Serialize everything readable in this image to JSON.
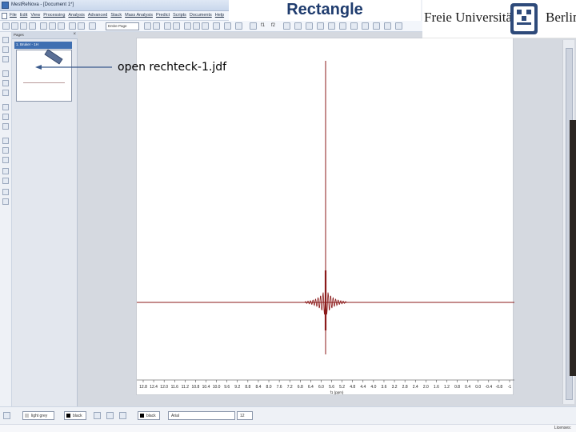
{
  "slide": {
    "title": "Rectangle",
    "logo": {
      "left_text": "Freie Universität",
      "right_text": "Berlin"
    },
    "annotation": "open rechteck-1.jdf"
  },
  "window": {
    "title": "MestReNova - [Document 1*]"
  },
  "menu": [
    "File",
    "Edit",
    "View",
    "Processing",
    "Analysis",
    "Advanced",
    "Stack",
    "Mass Analysis",
    "Predict",
    "Scripts",
    "Documents",
    "Help"
  ],
  "toolbar": {
    "page_mode": "Entire Page",
    "zoom_in": "f1",
    "zoom_out": "f2"
  },
  "pages_panel": {
    "header": "Pages",
    "page_label": "1. Bruker - 1H"
  },
  "statusbar": {
    "line_color": "light grey",
    "line_color_hex": "#c8c8c8",
    "fill_color": "black",
    "fill_color_hex": "#000000",
    "text_color": "black",
    "font": "Arial",
    "font_size": "12",
    "license": "Licenses:"
  },
  "spectrum": {
    "line_color": "#8b1a1a",
    "x_axis_title": "f1 (ppm)",
    "x_ticks": [
      "12.8",
      "12.4",
      "12.0",
      "11.6",
      "11.2",
      "10.8",
      "10.4",
      "10.0",
      "9.6",
      "9.2",
      "8.8",
      "8.4",
      "8.0",
      "7.6",
      "7.2",
      "6.8",
      "6.4",
      "6.0",
      "5.6",
      "5.2",
      "4.8",
      "4.4",
      "4.0",
      "3.6",
      "3.2",
      "2.8",
      "2.4",
      "2.0",
      "1.6",
      "1.2",
      "0.8",
      "0.4",
      "0.0",
      "-0.4",
      "-0.8",
      "-1"
    ]
  }
}
